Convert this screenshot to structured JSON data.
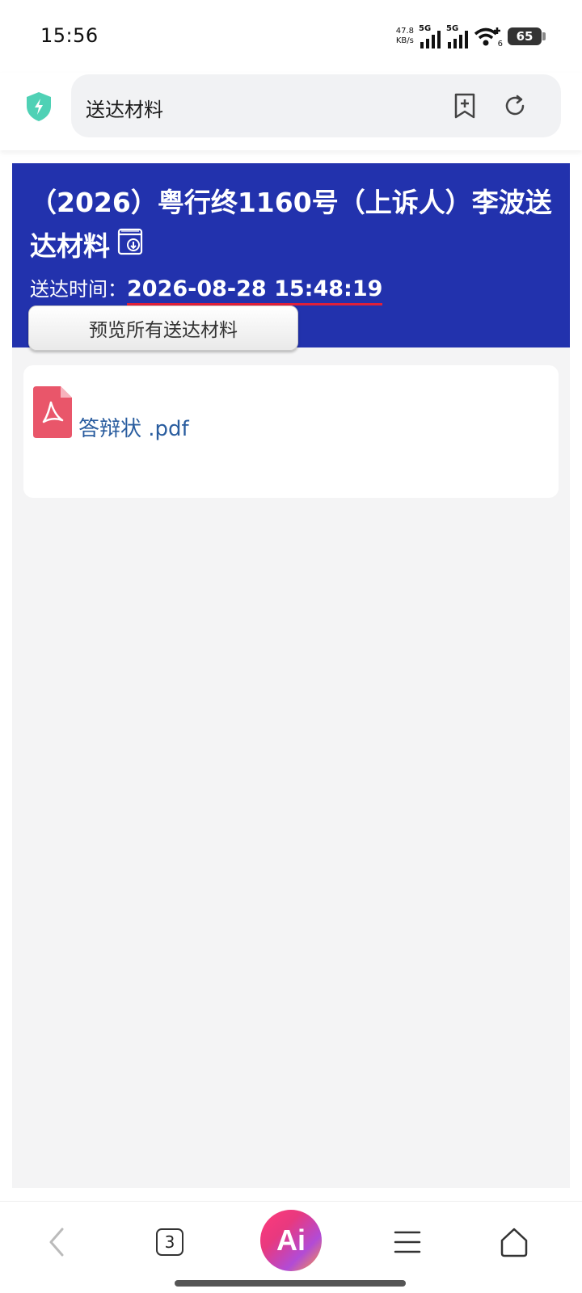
{
  "status_bar": {
    "time": "15:56",
    "net_speed_value": "47.8",
    "net_speed_unit": "KB/s",
    "sim1_label": "5G",
    "sim2_label": "5G",
    "wifi_sub": "6",
    "battery_level": "65"
  },
  "browser": {
    "address_text": "送达材料",
    "tab_count": "3",
    "ai_label": "Ai"
  },
  "page": {
    "title": "（2026）粤行终1160号（上诉人）李波送达材料",
    "time_label": "送达时间：",
    "time_value": "2026-08-28 15:48:19",
    "preview_button": "预览所有送达材料",
    "files": [
      {
        "name": "答辩状 .pdf",
        "icon": "pdf-icon"
      }
    ]
  },
  "colors": {
    "header_bg": "#2232ad",
    "underline": "#e0203a",
    "file_link": "#2a5d9f",
    "shield": "#4fd1b5",
    "pdf": "#e9566a"
  }
}
